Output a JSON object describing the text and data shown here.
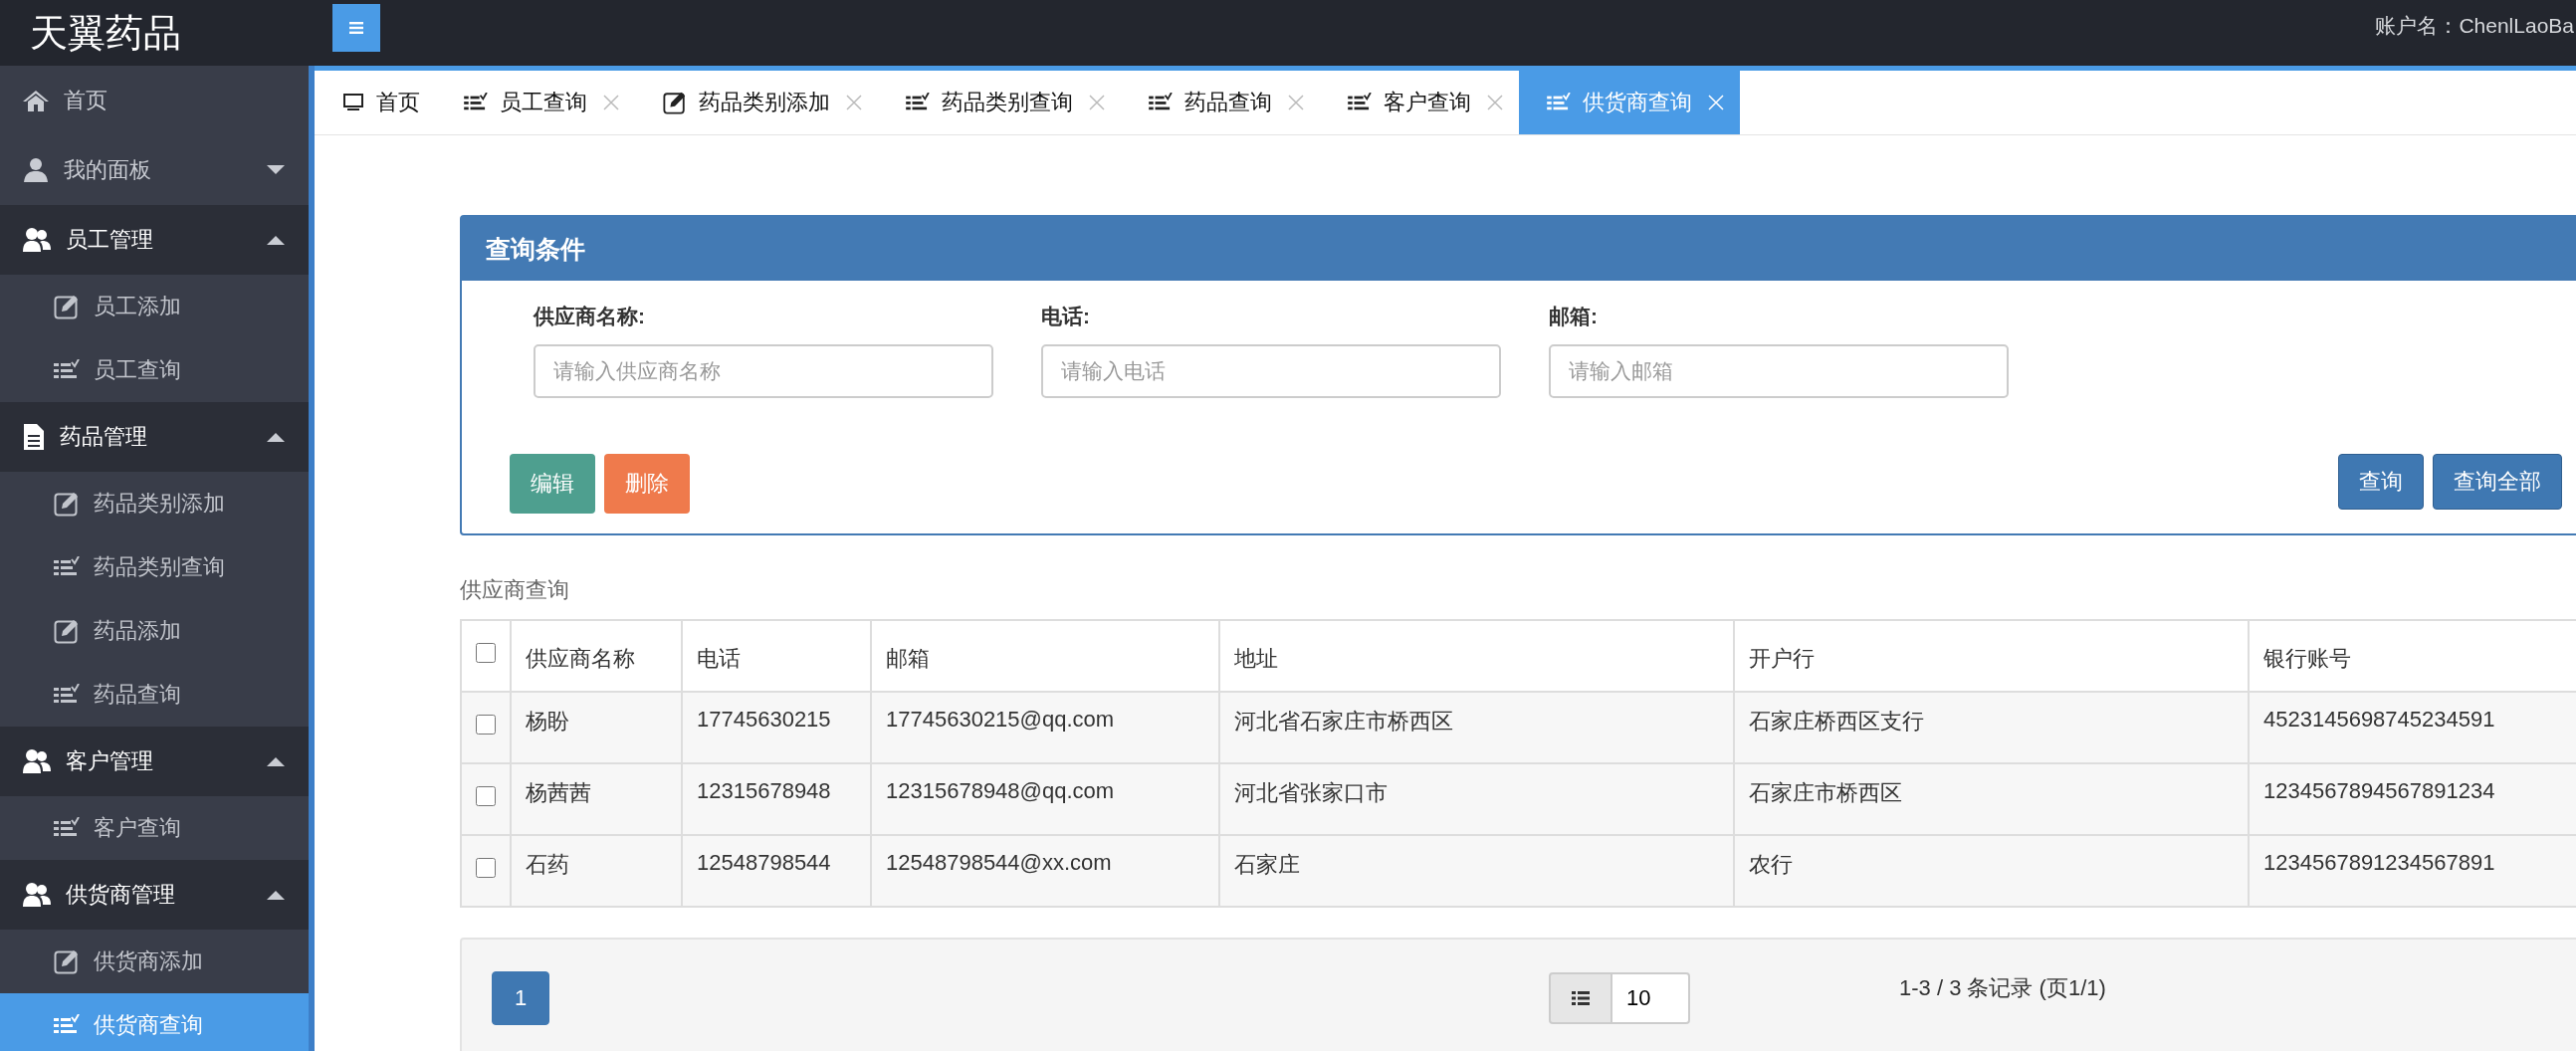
{
  "header": {
    "logo": "天翼药品",
    "account": "账户名：ChenlLaoBa"
  },
  "sidebar": {
    "items": [
      {
        "label": "首页",
        "kind": "link"
      },
      {
        "label": "我的面板",
        "kind": "group",
        "expanded": false
      },
      {
        "label": "员工管理",
        "kind": "group",
        "expanded": true,
        "children": [
          {
            "label": "员工添加",
            "kind": "form",
            "selected": false
          },
          {
            "label": "员工查询",
            "kind": "query",
            "selected": false
          }
        ]
      },
      {
        "label": "药品管理",
        "kind": "group",
        "expanded": true,
        "children": [
          {
            "label": "药品类别添加",
            "kind": "form",
            "selected": false
          },
          {
            "label": "药品类别查询",
            "kind": "query",
            "selected": false
          },
          {
            "label": "药品添加",
            "kind": "form",
            "selected": false
          },
          {
            "label": "药品查询",
            "kind": "query",
            "selected": false
          }
        ]
      },
      {
        "label": "客户管理",
        "kind": "group",
        "expanded": true,
        "children": [
          {
            "label": "客户查询",
            "kind": "query",
            "selected": false
          }
        ]
      },
      {
        "label": "供货商管理",
        "kind": "group",
        "expanded": true,
        "children": [
          {
            "label": "供货商添加",
            "kind": "form",
            "selected": false
          },
          {
            "label": "供货商查询",
            "kind": "query",
            "selected": true
          }
        ]
      }
    ]
  },
  "tabs": [
    {
      "label": "首页",
      "kind": "home",
      "closable": false,
      "selected": false
    },
    {
      "label": "员工查询",
      "kind": "query",
      "closable": true,
      "selected": false
    },
    {
      "label": "药品类别添加",
      "kind": "form",
      "closable": true,
      "selected": false
    },
    {
      "label": "药品类别查询",
      "kind": "query",
      "closable": true,
      "selected": false
    },
    {
      "label": "药品查询",
      "kind": "query",
      "closable": true,
      "selected": false
    },
    {
      "label": "客户查询",
      "kind": "query",
      "closable": true,
      "selected": false
    },
    {
      "label": "供货商查询",
      "kind": "query",
      "closable": true,
      "selected": true
    }
  ],
  "search_panel": {
    "title": "查询条件",
    "fields": [
      {
        "label": "供应商名称:",
        "placeholder": "请输入供应商名称"
      },
      {
        "label": "电话:",
        "placeholder": "请输入电话"
      },
      {
        "label": "邮箱:",
        "placeholder": "请输入邮箱"
      }
    ],
    "left_buttons": [
      {
        "label": "编辑",
        "kind": "success"
      },
      {
        "label": "删除",
        "kind": "danger"
      }
    ],
    "right_buttons": [
      {
        "label": "查询",
        "kind": "primary"
      },
      {
        "label": "查询全部",
        "kind": "primary"
      }
    ]
  },
  "table": {
    "caption": "供应商查询",
    "header_checked": false,
    "columns": [
      "供应商名称",
      "电话",
      "邮箱",
      "地址",
      "开户行",
      "银行账号"
    ],
    "rows": [
      {
        "checked": false,
        "cells": [
          "杨盼",
          "17745630215",
          "17745630215@qq.com",
          "河北省石家庄市桥西区",
          "石家庄桥西区支行",
          "4523145698745234591"
        ]
      },
      {
        "checked": false,
        "cells": [
          "杨茜茜",
          "12315678948",
          "12315678948@qq.com",
          "河北省张家口市",
          "石家庄市桥西区",
          "1234567894567891234"
        ]
      },
      {
        "checked": false,
        "cells": [
          "石药",
          "12548798544",
          "12548798544@xx.com",
          "石家庄",
          "农行",
          "1234567891234567891"
        ]
      }
    ]
  },
  "pagination": {
    "pages": [
      {
        "label": "1",
        "selected": true
      }
    ],
    "page_size": "10",
    "summary": "1-3 / 3 条记录 (页1/1)"
  }
}
